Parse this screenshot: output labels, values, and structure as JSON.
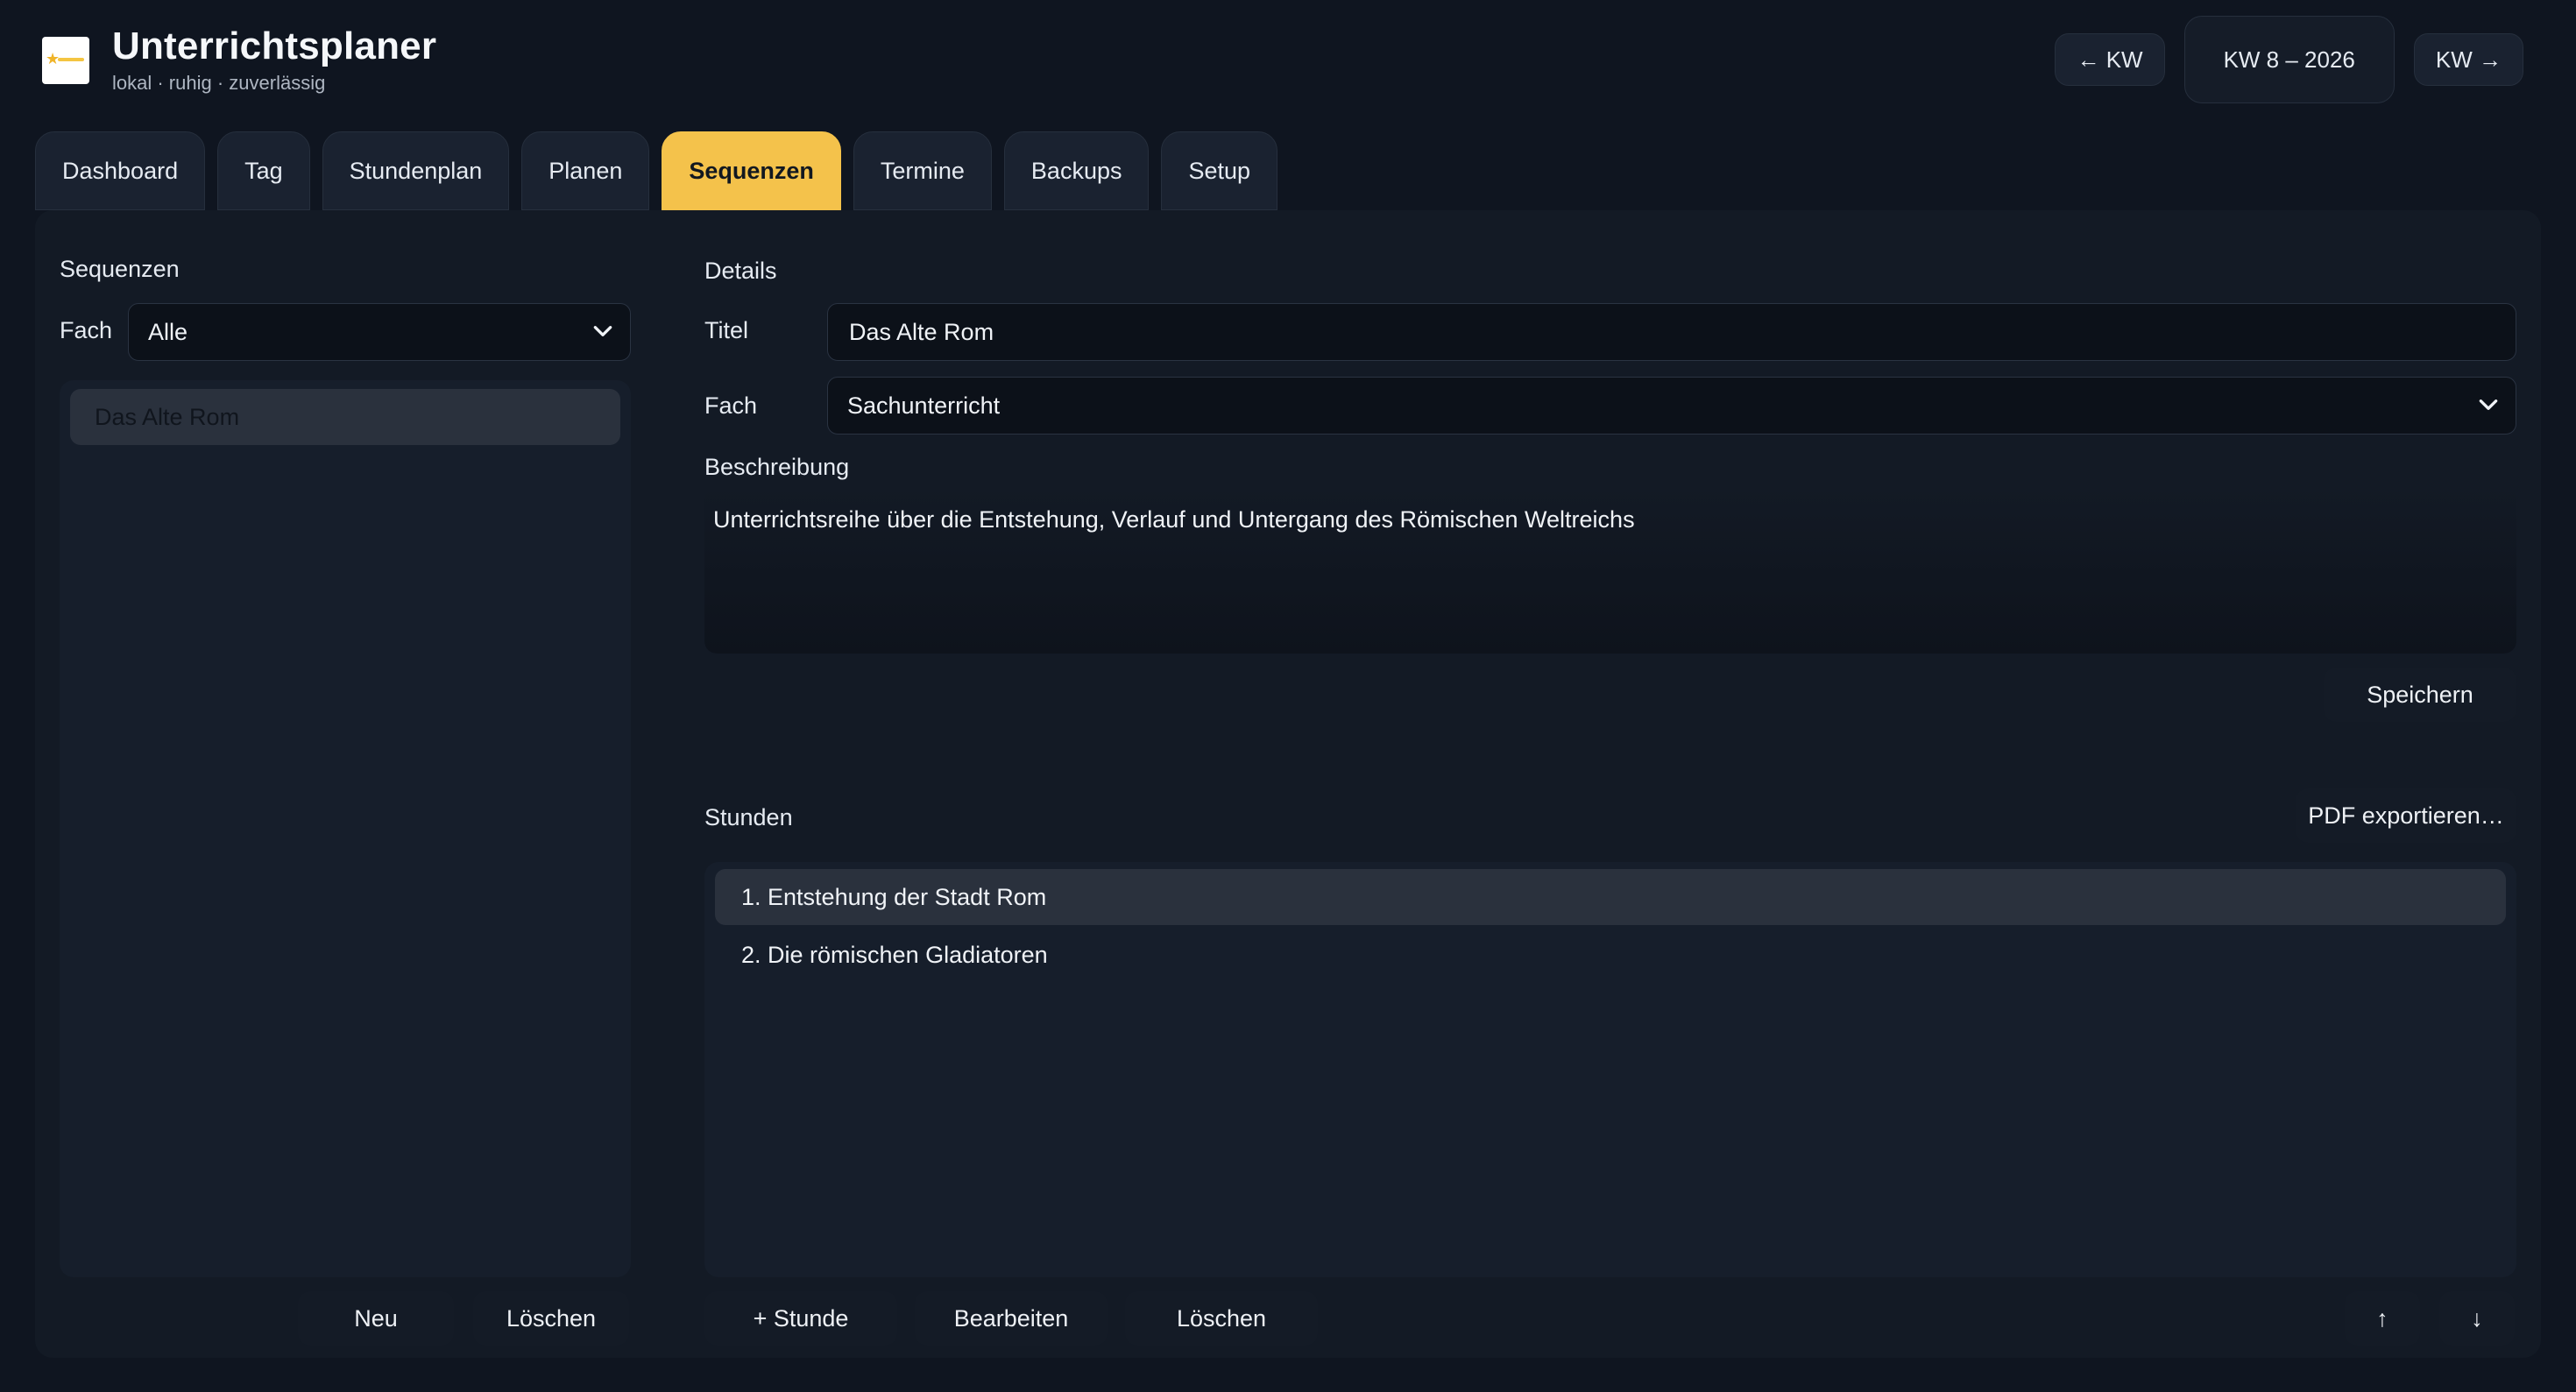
{
  "header": {
    "title": "Unterrichtsplaner",
    "subtitle": "lokal · ruhig · zuverlässig",
    "logo_icon": "star-logo-icon"
  },
  "week_nav": {
    "prev_label": "← KW",
    "current": "KW 8 – 2026",
    "next_label": "KW →"
  },
  "tabs": [
    {
      "label": "Dashboard",
      "active": false
    },
    {
      "label": "Tag",
      "active": false
    },
    {
      "label": "Stundenplan",
      "active": false
    },
    {
      "label": "Planen",
      "active": false
    },
    {
      "label": "Sequenzen",
      "active": true
    },
    {
      "label": "Termine",
      "active": false
    },
    {
      "label": "Backups",
      "active": false
    },
    {
      "label": "Setup",
      "active": false
    }
  ],
  "sequences": {
    "heading": "Sequenzen",
    "filter_label": "Fach",
    "filter_value": "Alle",
    "items": [
      {
        "label": "Das Alte Rom",
        "selected": true
      }
    ],
    "new_label": "Neu",
    "delete_label": "Löschen"
  },
  "details": {
    "heading": "Details",
    "title_label": "Titel",
    "title_value": "Das Alte Rom",
    "subject_label": "Fach",
    "subject_value": "Sachunterricht",
    "description_label": "Beschreibung",
    "description_value": "Unterrichtsreihe über die Entstehung, Verlauf und Untergang des Römischen Weltreichs",
    "save_label": "Speichern"
  },
  "lessons": {
    "heading": "Stunden",
    "export_label": "PDF exportieren…",
    "items": [
      {
        "label": "1. Entstehung der Stadt Rom",
        "selected": true
      },
      {
        "label": "2. Die römischen Gladiatoren",
        "selected": false
      }
    ],
    "add_label": "+ Stunde",
    "edit_label": "Bearbeiten",
    "delete_label": "Löschen",
    "up_label": "↑",
    "down_label": "↓"
  },
  "colors": {
    "background": "#0f1520",
    "accent": "#f4c24b",
    "card": "#131a25"
  }
}
